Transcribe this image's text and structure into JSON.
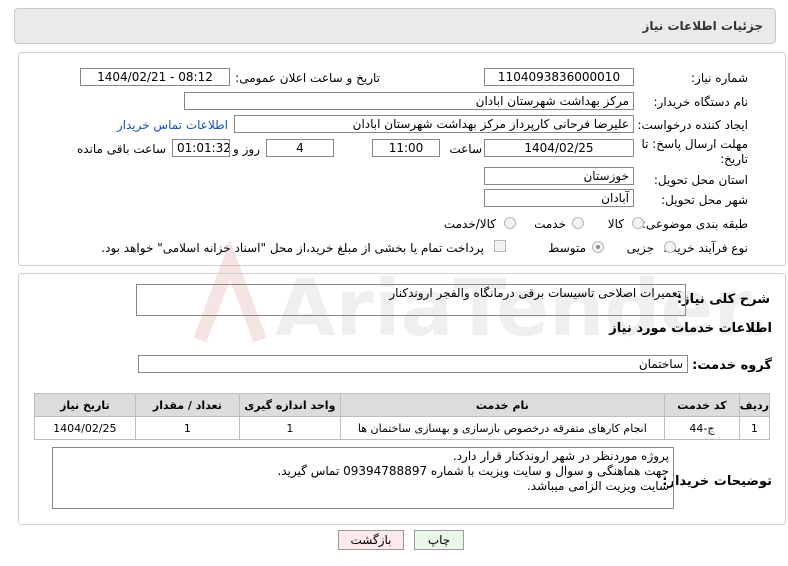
{
  "header": {
    "title": "جزئیات اطلاعات نیاز"
  },
  "form": {
    "need_number_label": "شماره نیاز:",
    "need_number": "1104093836000010",
    "announce_label": "تاریخ و ساعت اعلان عمومی:",
    "announce_value": "1404/02/21 - 08:12",
    "buyer_org_label": "نام دستگاه خریدار:",
    "buyer_org": "مرکز بهداشت شهرستان ابادان",
    "creator_label": "ایجاد کننده درخواست:",
    "creator": "علیرضا فرحانی کارپرداز مرکز بهداشت شهرستان ابادان",
    "contact_link": "اطلاعات تماس خریدار",
    "deadline_label_1": "مهلت ارسال پاسخ: تا",
    "deadline_label_2": "تاریخ:",
    "deadline_date": "1404/02/25",
    "time_label": "ساعت",
    "deadline_time": "11:00",
    "days_value": "4",
    "days_label": "روز و",
    "remaining_time": "01:01:32",
    "remaining_label": "ساعت باقی مانده",
    "province_label": "استان محل تحویل:",
    "province": "خوزستان",
    "city_label": "شهر محل تحویل:",
    "city": "آبادان",
    "category_label": "طبقه بندی موضوعی:",
    "category_options": [
      "کالا",
      "خدمت",
      "کالا/خدمت"
    ],
    "process_label": "نوع فرآیند خرید :",
    "process_options": [
      "جزیی",
      "متوسط"
    ],
    "payment_note": "پرداخت تمام یا بخشی از مبلغ خرید،از محل \"اسناد خزانه اسلامی\" خواهد بود."
  },
  "details": {
    "summary_label": "شرح کلی نیاز:",
    "summary": "تعمیرات اصلاحی تاسیسات برقی درمانگاه والفجر اروندکنار",
    "services_title": "اطلاعات خدمات مورد نیاز",
    "group_label": "گروه خدمت:",
    "group": "ساختمان",
    "table": {
      "headers": [
        "ردیف",
        "کد خدمت",
        "نام خدمت",
        "واحد اندازه گیری",
        "تعداد / مقدار",
        "تاریخ نیاز"
      ],
      "rows": [
        [
          "1",
          "ج-44",
          "انجام کارهای متفرقه درخصوص بازسازی و بهسازی ساختمان ها",
          "1",
          "1",
          "1404/02/25"
        ]
      ]
    },
    "buyer_notes_label": "توضیحات خریدار:",
    "buyer_notes": [
      "پروژه موردنظر در شهر اروندکنار قرار دارد.",
      "جهت هماهنگی و سوال و سایت ویزیت با شماره 09394788897 تماس گیرید.",
      "سایت ویزیت الزامی میباشد."
    ]
  },
  "buttons": {
    "print": "چاپ",
    "back": "بازگشت"
  },
  "watermark": {
    "text": "AriaTender.neT"
  },
  "colors": {
    "link": "#1a53b0",
    "back_button": "#fde9e9",
    "print_button": "#e9f7e9",
    "watermark": "#c0392b"
  }
}
